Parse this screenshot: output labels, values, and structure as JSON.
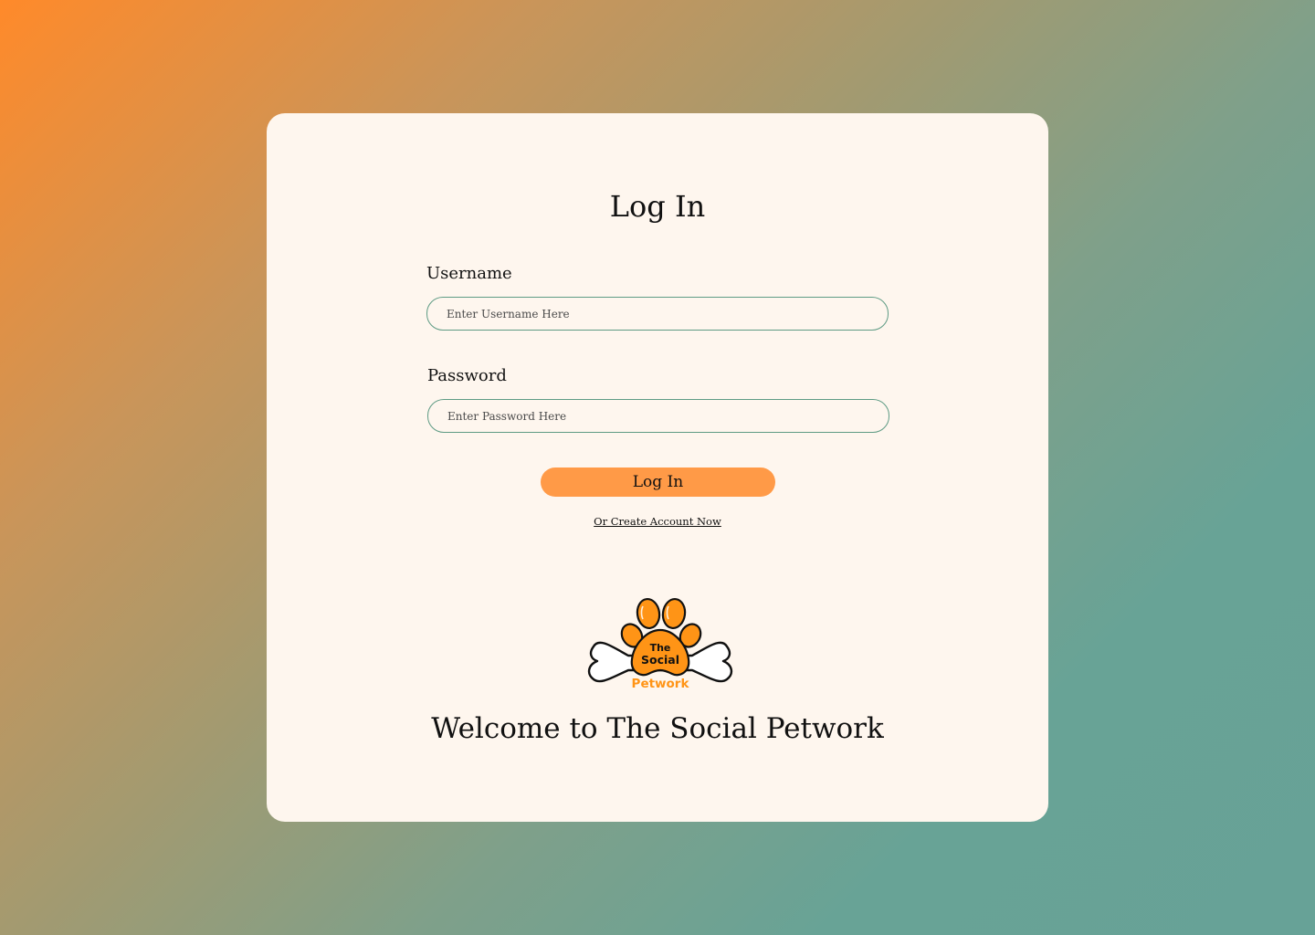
{
  "login": {
    "title": "Log In",
    "username_label": "Username",
    "username_placeholder": "Enter Username Here",
    "password_label": "Password",
    "password_placeholder": "Enter Password Here",
    "submit_label": "Log In",
    "create_account_link": "Or Create Account Now"
  },
  "logo": {
    "line1": "The",
    "line2": "Social",
    "line3": "Petwork",
    "icon": "paw-bone-logo"
  },
  "welcome_text": "Welcome to The Social Petwork",
  "colors": {
    "background_start": "#FF8A2A",
    "background_end": "#67A297",
    "card": "#FEF6EE",
    "button": "#FF9A47",
    "input_border": "#5E9B84",
    "logo_orange": "#FF9416"
  }
}
